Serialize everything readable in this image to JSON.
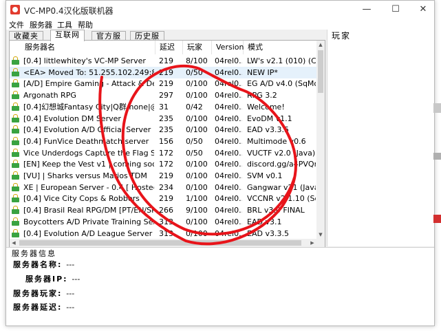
{
  "window": {
    "title": "VC-MP0.4汉化版联机器",
    "controls": {
      "minimize": "—",
      "maximize": "☐",
      "close": "✕"
    },
    "accent_icon_color": "#e23b2e"
  },
  "menu": [
    "文件",
    "服务器",
    "工具",
    "帮助"
  ],
  "tabs": [
    "收藏夹",
    "互联网",
    "官方服",
    "历史服"
  ],
  "active_tab_index": 1,
  "list": {
    "columns": [
      "服务器名",
      "延迟",
      "玩家",
      "Version",
      "模式"
    ],
    "rows": [
      {
        "name": "[0.4] littlewhitey's VC-MP Server",
        "ping": "219",
        "players": "8/100",
        "version": "04rel0...",
        "mode": "LW's v2.1 (010) (C++)"
      },
      {
        "name": "<EA> Moved To: 51.255.102.249:8192",
        "ping": "219",
        "players": "0/50",
        "version": "04rel0...",
        "mode": "NEW IP*"
      },
      {
        "name": "[A/D] Empire Gaming - Attack & Def...",
        "ping": "219",
        "players": "0/100",
        "version": "04rel0...",
        "mode": "EG A/D v4.0 (SqMod) ..."
      },
      {
        "name": "Argonath RPG",
        "ping": "297",
        "players": "0/100",
        "version": "04rel0...",
        "mode": "RPG 3.2"
      },
      {
        "name": "[0.4]幻想城Fantasy City|Q群:none|@Fxz",
        "ping": "31",
        "players": "0/42",
        "version": "04rel0...",
        "mode": "Welcome!"
      },
      {
        "name": "[0.4] Evolution DM Server",
        "ping": "235",
        "players": "0/100",
        "version": "04rel0...",
        "mode": "EvoDM v1.1"
      },
      {
        "name": "[0.4] Evolution A/D Official Server",
        "ping": "235",
        "players": "0/100",
        "version": "04rel0...",
        "mode": "EAD v3.3.5"
      },
      {
        "name": "[0.4] FunVice Deathmatch server",
        "ping": "156",
        "players": "0/50",
        "version": "04rel0...",
        "mode": "Multimode v0.6"
      },
      {
        "name": "Vice Underdogs Capture the Flag Se...",
        "ping": "172",
        "players": "0/50",
        "version": "04rel0...",
        "mode": "VUCTF v2.0 (Java)"
      },
      {
        "name": "[EN] Keep the Vest v1 | coming soon",
        "ping": "172",
        "players": "0/100",
        "version": "04rel0...",
        "mode": "discord.gg/a4PVQr6n..."
      },
      {
        "name": "[VU] | Sharks versus Marios TDM",
        "ping": "219",
        "players": "0/100",
        "version": "04rel0...",
        "mode": "SVM v0.1"
      },
      {
        "name": "XE | European Server - 0.4 [ Hosted ...",
        "ping": "234",
        "players": "0/100",
        "version": "04rel0...",
        "mode": "Gangwar v21 (Java)"
      },
      {
        "name": "[0.4] Vice City Cops & Robbers",
        "ping": "219",
        "players": "1/100",
        "version": "04rel0...",
        "mode": "VCCNR v2.1.10 (SqMo..."
      },
      {
        "name": "[0.4] Brasil Real RPG/DM [PT/EN/SP]",
        "ping": "266",
        "players": "9/100",
        "version": "04rel0...",
        "mode": "BRL v3.0 FINAL"
      },
      {
        "name": "Boycotters A/D Private Training Server",
        "ping": "313",
        "players": "0/100",
        "version": "04rel0...",
        "mode": "EAD v3.1"
      },
      {
        "name": "[0.4] Evolution A/D League Server",
        "ping": "313",
        "players": "0/100",
        "version": "04rel0...",
        "mode": "EAD v3.3.5"
      }
    ],
    "selected_row_index": 1
  },
  "players_panel": {
    "label": "玩家"
  },
  "info": {
    "title": "服务器信息",
    "fields": [
      {
        "label": "服务器名称:",
        "value": "---"
      },
      {
        "label": "服务器IP:",
        "value": "---"
      },
      {
        "label": "服务器玩家:",
        "value": "---"
      },
      {
        "label": "服务器延迟:",
        "value": "---"
      }
    ]
  },
  "annotation_color": "#e8141a"
}
